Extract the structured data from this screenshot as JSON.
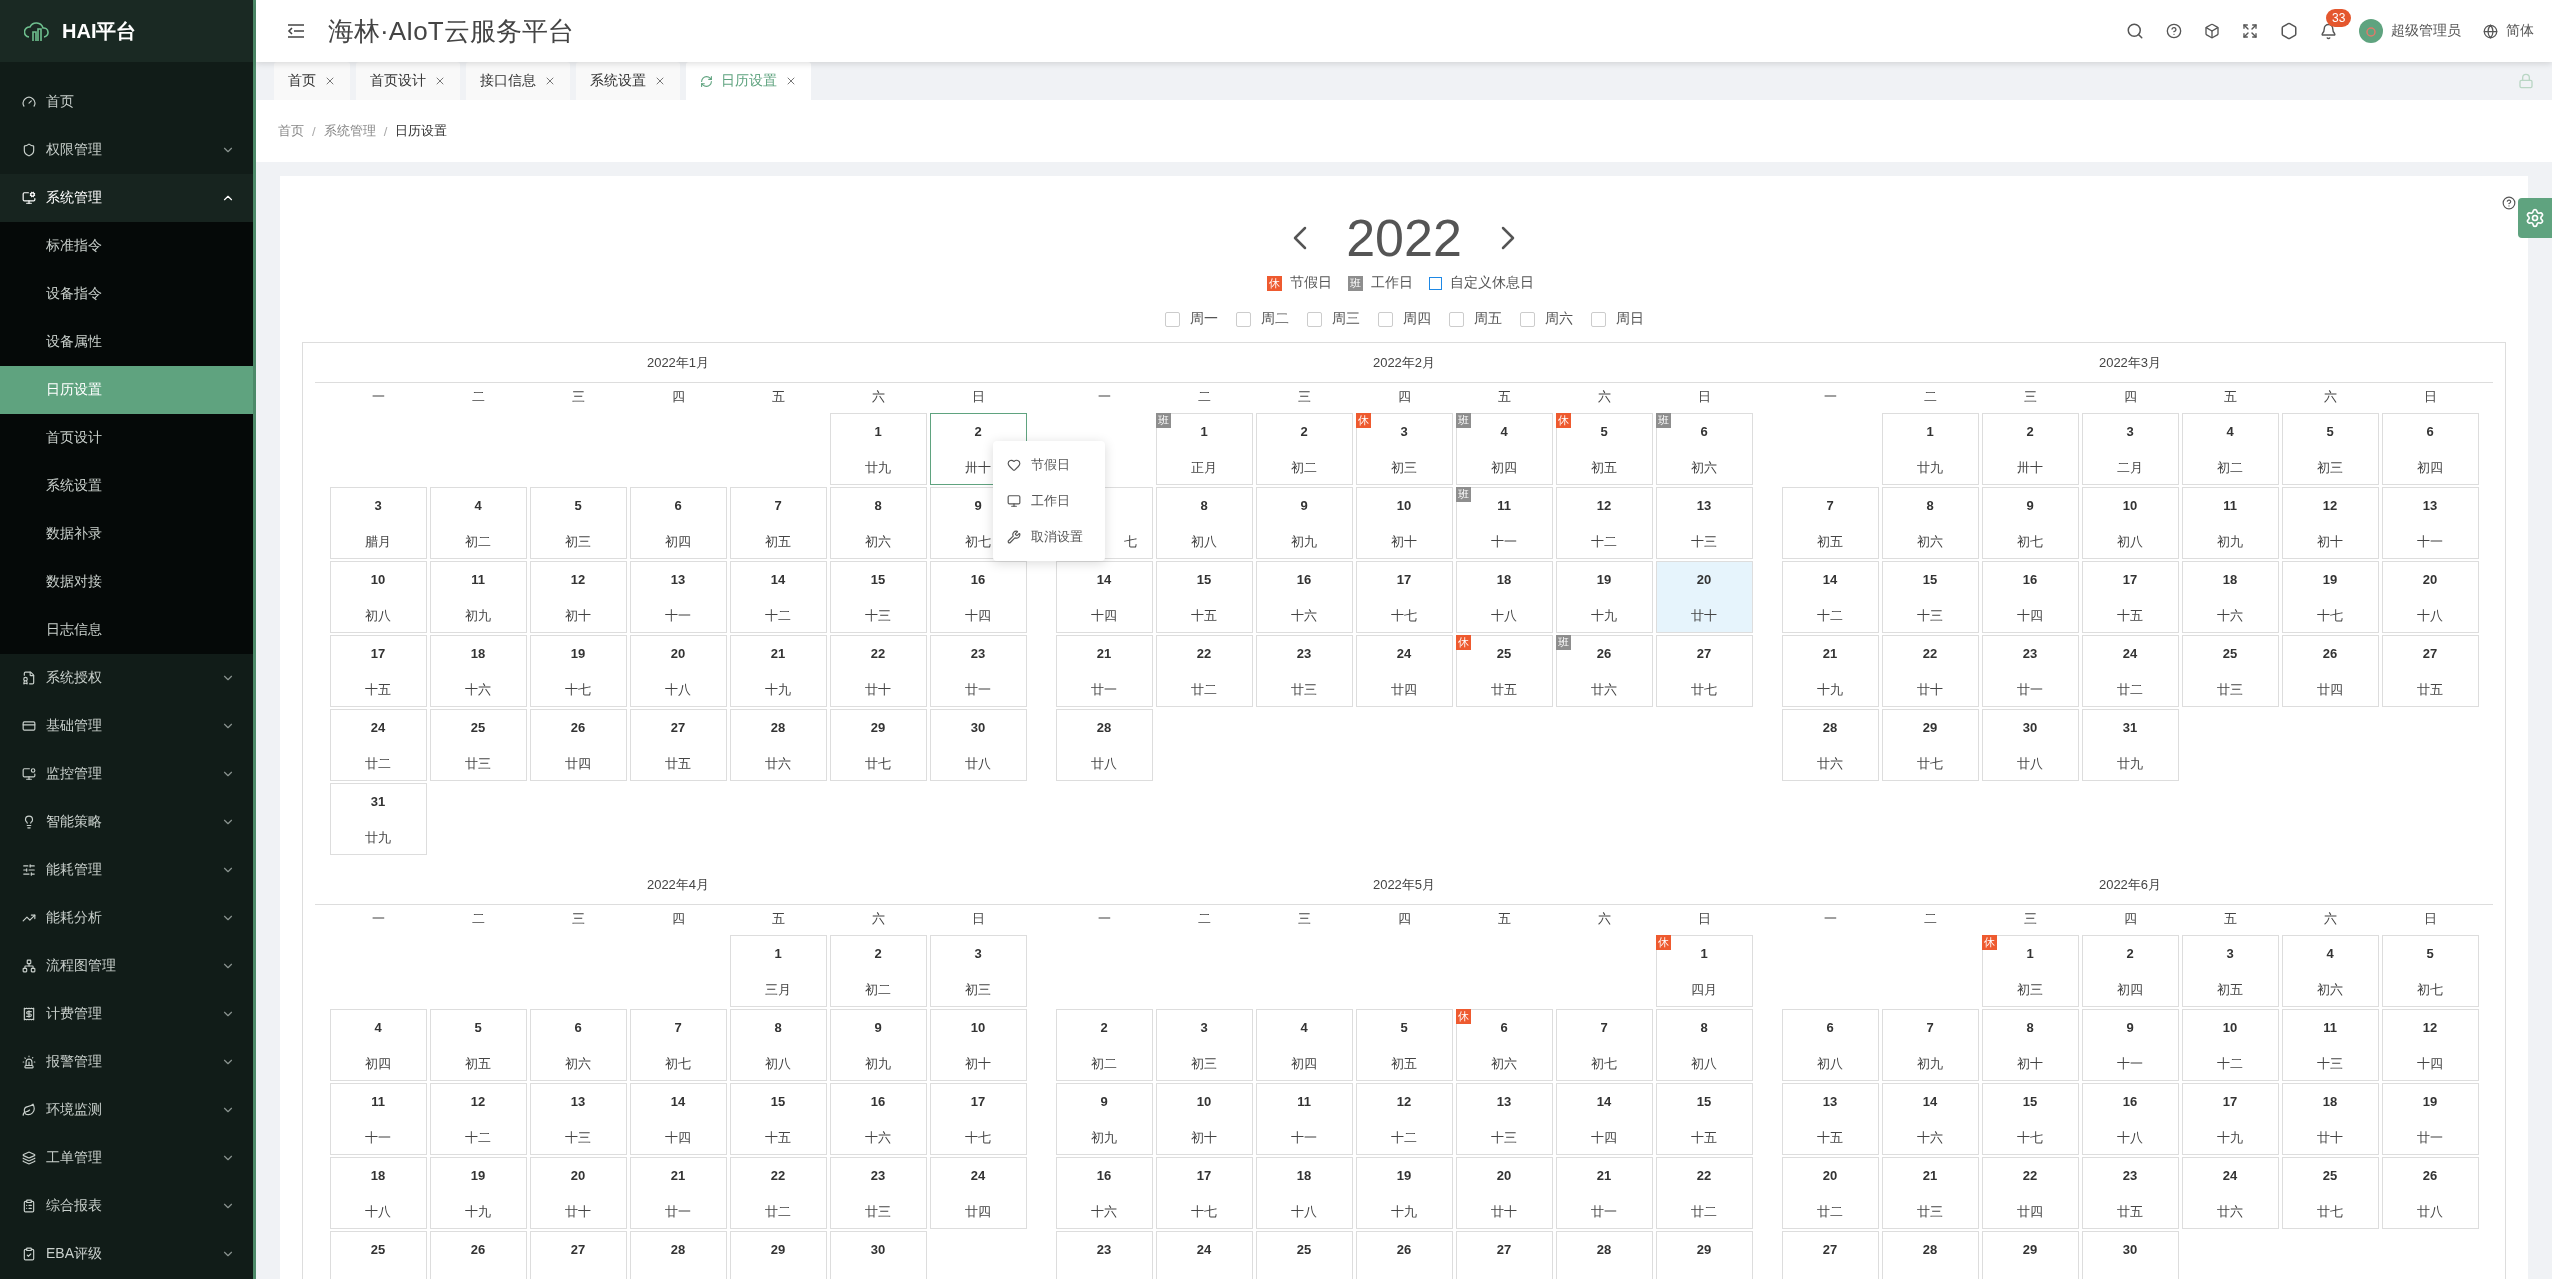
{
  "sidebar": {
    "logo": "HAI平台",
    "items": [
      {
        "kind": "link",
        "label": "首页"
      },
      {
        "kind": "group",
        "label": "权限管理",
        "expanded": false
      },
      {
        "kind": "group",
        "label": "系统管理",
        "expanded": true,
        "children": [
          {
            "label": "标准指令",
            "selected": false
          },
          {
            "label": "设备指令",
            "selected": false
          },
          {
            "label": "设备属性",
            "selected": false
          },
          {
            "label": "日历设置",
            "selected": true
          },
          {
            "label": "首页设计",
            "selected": false
          },
          {
            "label": "系统设置",
            "selected": false
          },
          {
            "label": "数据补录",
            "selected": false
          },
          {
            "label": "数据对接",
            "selected": false
          },
          {
            "label": "日志信息",
            "selected": false
          }
        ]
      },
      {
        "kind": "group",
        "label": "系统授权",
        "expanded": false
      },
      {
        "kind": "group",
        "label": "基础管理",
        "expanded": false
      },
      {
        "kind": "group",
        "label": "监控管理",
        "expanded": false
      },
      {
        "kind": "group",
        "label": "智能策略",
        "expanded": false
      },
      {
        "kind": "group",
        "label": "能耗管理",
        "expanded": false
      },
      {
        "kind": "group",
        "label": "能耗分析",
        "expanded": false
      },
      {
        "kind": "group",
        "label": "流程图管理",
        "expanded": false
      },
      {
        "kind": "group",
        "label": "计费管理",
        "expanded": false
      },
      {
        "kind": "group",
        "label": "报警管理",
        "expanded": false
      },
      {
        "kind": "group",
        "label": "环境监测",
        "expanded": false
      },
      {
        "kind": "group",
        "label": "工单管理",
        "expanded": false
      },
      {
        "kind": "group",
        "label": "综合报表",
        "expanded": false
      },
      {
        "kind": "group",
        "label": "EBA评级",
        "expanded": false
      }
    ]
  },
  "header": {
    "title": "海林·AIoT云服务平台",
    "notifications": "33",
    "user": "超级管理员",
    "language": "简体"
  },
  "tabs": [
    {
      "label": "首页",
      "selected": false
    },
    {
      "label": "首页设计",
      "selected": false
    },
    {
      "label": "接口信息",
      "selected": false
    },
    {
      "label": "系统设置",
      "selected": false
    },
    {
      "label": "日历设置",
      "selected": true
    }
  ],
  "breadcrumb": [
    {
      "label": "首页"
    },
    {
      "separator": "/",
      "label": "系统管理"
    },
    {
      "separator": "/",
      "label": "日历设置"
    }
  ],
  "calendar": {
    "year": "2022",
    "legend": [
      {
        "kind": "holiday",
        "badge": "休",
        "label": "节假日"
      },
      {
        "kind": "workday",
        "badge": "班",
        "label": "工作日"
      },
      {
        "kind": "custom",
        "label": "自定义休息日"
      }
    ],
    "weekday_filters": [
      {
        "label": "周一",
        "checked": false
      },
      {
        "label": "周二",
        "checked": false
      },
      {
        "label": "周三",
        "checked": false
      },
      {
        "label": "周四",
        "checked": false
      },
      {
        "label": "周五",
        "checked": false
      },
      {
        "label": "周六",
        "checked": false
      },
      {
        "label": "周日",
        "checked": false
      }
    ],
    "months": [
      {
        "title": "2022年1月",
        "weekdays": [
          "一",
          "二",
          "三",
          "四",
          "五",
          "六",
          "日"
        ],
        "weeks": [
          [
            {
              "day": "1",
              "lunar": "廿九",
              "selected": false,
              "custom_rest": false
            },
            {
              "day": "2",
              "lunar": "卅十",
              "selected": true,
              "custom_rest": false
            }
          ],
          [
            {
              "day": "3",
              "lunar": "腊月",
              "selected": false,
              "custom_rest": false
            },
            {
              "day": "4",
              "lunar": "初二",
              "selected": false,
              "custom_rest": false
            },
            {
              "day": "5",
              "lunar": "初三",
              "selected": false,
              "custom_rest": false
            },
            {
              "day": "6",
              "lunar": "初四",
              "selected": false,
              "custom_rest": false
            },
            {
              "day": "7",
              "lunar": "初五",
              "selected": false,
              "custom_rest": false
            },
            {
              "day": "8",
              "lunar": "初六",
              "selected": false,
              "custom_rest": false
            },
            {
              "day": "9",
              "lunar": "初七",
              "selected": false,
              "custom_rest": false
            }
          ],
          [
            {
              "day": "10",
              "lunar": "初八",
              "selected": false,
              "custom_rest": false
            },
            {
              "day": "11",
              "lunar": "初九",
              "selected": false,
              "custom_rest": false
            },
            {
              "day": "12",
              "lunar": "初十",
              "selected": false,
              "custom_rest": false
            },
            {
              "day": "13",
              "lunar": "十一",
              "selected": false,
              "custom_rest": false
            },
            {
              "day": "14",
              "lunar": "十二",
              "selected": false,
              "custom_rest": false
            },
            {
              "day": "15",
              "lunar": "十三",
              "selected": false,
              "custom_rest": false
            },
            {
              "day": "16",
              "lunar": "十四",
              "selected": false,
              "custom_rest": false
            }
          ],
          [
            {
              "day": "17",
              "lunar": "十五",
              "selected": false,
              "custom_rest": false
            },
            {
              "day": "18",
              "lunar": "十六",
              "selected": false,
              "custom_rest": false
            },
            {
              "day": "19",
              "lunar": "十七",
              "selected": false,
              "custom_rest": false
            },
            {
              "day": "20",
              "lunar": "十八",
              "selected": false,
              "custom_rest": false
            },
            {
              "day": "21",
              "lunar": "十九",
              "selected": false,
              "custom_rest": false
            },
            {
              "day": "22",
              "lunar": "廿十",
              "selected": false,
              "custom_rest": false
            },
            {
              "day": "23",
              "lunar": "廿一",
              "selected": false,
              "custom_rest": false
            }
          ],
          [
            {
              "day": "24",
              "lunar": "廿二",
              "selected": false,
              "custom_rest": false
            },
            {
              "day": "25",
              "lunar": "廿三",
              "selected": false,
              "custom_rest": false
            },
            {
              "day": "26",
              "lunar": "廿四",
              "selected": false,
              "custom_rest": false
            },
            {
              "day": "27",
              "lunar": "廿五",
              "selected": false,
              "custom_rest": false
            },
            {
              "day": "28",
              "lunar": "廿六",
              "selected": false,
              "custom_rest": false
            },
            {
              "day": "29",
              "lunar": "廿七",
              "selected": false,
              "custom_rest": false
            },
            {
              "day": "30",
              "lunar": "廿八",
              "selected": false,
              "custom_rest": false
            }
          ],
          [
            {
              "day": "31",
              "lunar": "廿九",
              "selected": false,
              "custom_rest": false
            }
          ]
        ]
      },
      {
        "title": "2022年2月",
        "weekdays": [
          "一",
          "二",
          "三",
          "四",
          "五",
          "六",
          "日"
        ],
        "weeks": [
          [
            {
              "day": "1",
              "lunar": "正月",
              "selected": false,
              "custom_rest": false,
              "tag": {
                "kind": "workday",
                "text": "班"
              }
            },
            {
              "day": "2",
              "lunar": "初二",
              "selected": false,
              "custom_rest": false
            },
            {
              "day": "3",
              "lunar": "初三",
              "selected": false,
              "custom_rest": false,
              "tag": {
                "kind": "holiday",
                "text": "休"
              }
            },
            {
              "day": "4",
              "lunar": "初四",
              "selected": false,
              "custom_rest": false,
              "tag": {
                "kind": "workday",
                "text": "班"
              }
            },
            {
              "day": "5",
              "lunar": "初五",
              "selected": false,
              "custom_rest": false,
              "tag": {
                "kind": "holiday",
                "text": "休"
              }
            },
            {
              "day": "6",
              "lunar": "初六",
              "selected": false,
              "custom_rest": false,
              "tag": {
                "kind": "workday",
                "text": "班"
              }
            }
          ],
          [
            {
              "lunar": "七",
              "selected": false,
              "custom_rest": false
            },
            {
              "day": "8",
              "lunar": "初八",
              "selected": false,
              "custom_rest": false
            },
            {
              "day": "9",
              "lunar": "初九",
              "selected": false,
              "custom_rest": false
            },
            {
              "day": "10",
              "lunar": "初十",
              "selected": false,
              "custom_rest": false
            },
            {
              "day": "11",
              "lunar": "十一",
              "selected": false,
              "custom_rest": false,
              "tag": {
                "kind": "workday",
                "text": "班"
              }
            },
            {
              "day": "12",
              "lunar": "十二",
              "selected": false,
              "custom_rest": false
            },
            {
              "day": "13",
              "lunar": "十三",
              "selected": false,
              "custom_rest": false
            }
          ],
          [
            {
              "day": "14",
              "lunar": "十四",
              "selected": false,
              "custom_rest": false
            },
            {
              "day": "15",
              "lunar": "十五",
              "selected": false,
              "custom_rest": false
            },
            {
              "day": "16",
              "lunar": "十六",
              "selected": false,
              "custom_rest": false
            },
            {
              "day": "17",
              "lunar": "十七",
              "selected": false,
              "custom_rest": false
            },
            {
              "day": "18",
              "lunar": "十八",
              "selected": false,
              "custom_rest": false
            },
            {
              "day": "19",
              "lunar": "十九",
              "selected": false,
              "custom_rest": false
            },
            {
              "day": "20",
              "lunar": "廿十",
              "selected": false,
              "custom_rest": true
            }
          ],
          [
            {
              "day": "21",
              "lunar": "廿一",
              "selected": false,
              "custom_rest": false
            },
            {
              "day": "22",
              "lunar": "廿二",
              "selected": false,
              "custom_rest": false
            },
            {
              "day": "23",
              "lunar": "廿三",
              "selected": false,
              "custom_rest": false
            },
            {
              "day": "24",
              "lunar": "廿四",
              "selected": false,
              "custom_rest": false
            },
            {
              "day": "25",
              "lunar": "廿五",
              "selected": false,
              "custom_rest": false,
              "tag": {
                "kind": "holiday",
                "text": "休"
              }
            },
            {
              "day": "26",
              "lunar": "廿六",
              "selected": false,
              "custom_rest": false,
              "tag": {
                "kind": "workday",
                "text": "班"
              }
            },
            {
              "day": "27",
              "lunar": "廿七",
              "selected": false,
              "custom_rest": false
            }
          ],
          [
            {
              "day": "28",
              "lunar": "廿八",
              "selected": false,
              "custom_rest": false
            }
          ]
        ]
      },
      {
        "title": "2022年3月",
        "weekdays": [
          "一",
          "二",
          "三",
          "四",
          "五",
          "六",
          "日"
        ],
        "weeks": [
          [
            {
              "day": "1",
              "lunar": "廿九",
              "selected": false,
              "custom_rest": false
            },
            {
              "day": "2",
              "lunar": "卅十",
              "selected": false,
              "custom_rest": false
            },
            {
              "day": "3",
              "lunar": "二月",
              "selected": false,
              "custom_rest": false
            },
            {
              "day": "4",
              "lunar": "初二",
              "selected": false,
              "custom_rest": false
            },
            {
              "day": "5",
              "lunar": "初三",
              "selected": false,
              "custom_rest": false
            },
            {
              "day": "6",
              "lunar": "初四",
              "selected": false,
              "custom_rest": false
            }
          ],
          [
            {
              "day": "7",
              "lunar": "初五",
              "selected": false,
              "custom_rest": false
            },
            {
              "day": "8",
              "lunar": "初六",
              "selected": false,
              "custom_rest": false
            },
            {
              "day": "9",
              "lunar": "初七",
              "selected": false,
              "custom_rest": false
            },
            {
              "day": "10",
              "lunar": "初八",
              "selected": false,
              "custom_rest": false
            },
            {
              "day": "11",
              "lunar": "初九",
              "selected": false,
              "custom_rest": false
            },
            {
              "day": "12",
              "lunar": "初十",
              "selected": false,
              "custom_rest": false
            },
            {
              "day": "13",
              "lunar": "十一",
              "selected": false,
              "custom_rest": false
            }
          ],
          [
            {
              "day": "14",
              "lunar": "十二",
              "selected": false,
              "custom_rest": false
            },
            {
              "day": "15",
              "lunar": "十三",
              "selected": false,
              "custom_rest": false
            },
            {
              "day": "16",
              "lunar": "十四",
              "selected": false,
              "custom_rest": false
            },
            {
              "day": "17",
              "lunar": "十五",
              "selected": false,
              "custom_rest": false
            },
            {
              "day": "18",
              "lunar": "十六",
              "selected": false,
              "custom_rest": false
            },
            {
              "day": "19",
              "lunar": "十七",
              "selected": false,
              "custom_rest": false
            },
            {
              "day": "20",
              "lunar": "十八",
              "selected": false,
              "custom_rest": false
            }
          ],
          [
            {
              "day": "21",
              "lunar": "十九",
              "selected": false,
              "custom_rest": false
            },
            {
              "day": "22",
              "lunar": "廿十",
              "selected": false,
              "custom_rest": false
            },
            {
              "day": "23",
              "lunar": "廿一",
              "selected": false,
              "custom_rest": false
            },
            {
              "day": "24",
              "lunar": "廿二",
              "selected": false,
              "custom_rest": false
            },
            {
              "day": "25",
              "lunar": "廿三",
              "selected": false,
              "custom_rest": false
            },
            {
              "day": "26",
              "lunar": "廿四",
              "selected": false,
              "custom_rest": false
            },
            {
              "day": "27",
              "lunar": "廿五",
              "selected": false,
              "custom_rest": false
            }
          ],
          [
            {
              "day": "28",
              "lunar": "廿六",
              "selected": false,
              "custom_rest": false
            },
            {
              "day": "29",
              "lunar": "廿七",
              "selected": false,
              "custom_rest": false
            },
            {
              "day": "30",
              "lunar": "廿八",
              "selected": false,
              "custom_rest": false
            },
            {
              "day": "31",
              "lunar": "廿九",
              "selected": false,
              "custom_rest": false
            }
          ]
        ]
      },
      {
        "title": "2022年4月",
        "weekdays": [
          "一",
          "二",
          "三",
          "四",
          "五",
          "六",
          "日"
        ],
        "weeks": [
          [
            {
              "day": "1",
              "lunar": "三月",
              "selected": false,
              "custom_rest": false
            },
            {
              "day": "2",
              "lunar": "初二",
              "selected": false,
              "custom_rest": false
            },
            {
              "day": "3",
              "lunar": "初三",
              "selected": false,
              "custom_rest": false
            }
          ],
          [
            {
              "day": "4",
              "lunar": "初四",
              "selected": false,
              "custom_rest": false
            },
            {
              "day": "5",
              "lunar": "初五",
              "selected": false,
              "custom_rest": false
            },
            {
              "day": "6",
              "lunar": "初六",
              "selected": false,
              "custom_rest": false
            },
            {
              "day": "7",
              "lunar": "初七",
              "selected": false,
              "custom_rest": false
            },
            {
              "day": "8",
              "lunar": "初八",
              "selected": false,
              "custom_rest": false
            },
            {
              "day": "9",
              "lunar": "初九",
              "selected": false,
              "custom_rest": false
            },
            {
              "day": "10",
              "lunar": "初十",
              "selected": false,
              "custom_rest": false
            }
          ],
          [
            {
              "day": "11",
              "lunar": "十一",
              "selected": false,
              "custom_rest": false
            },
            {
              "day": "12",
              "lunar": "十二",
              "selected": false,
              "custom_rest": false
            },
            {
              "day": "13",
              "lunar": "十三",
              "selected": false,
              "custom_rest": false
            },
            {
              "day": "14",
              "lunar": "十四",
              "selected": false,
              "custom_rest": false
            },
            {
              "day": "15",
              "lunar": "十五",
              "selected": false,
              "custom_rest": false
            },
            {
              "day": "16",
              "lunar": "十六",
              "selected": false,
              "custom_rest": false
            },
            {
              "day": "17",
              "lunar": "十七",
              "selected": false,
              "custom_rest": false
            }
          ],
          [
            {
              "day": "18",
              "lunar": "十八",
              "selected": false,
              "custom_rest": false
            },
            {
              "day": "19",
              "lunar": "十九",
              "selected": false,
              "custom_rest": false
            },
            {
              "day": "20",
              "lunar": "廿十",
              "selected": false,
              "custom_rest": false
            },
            {
              "day": "21",
              "lunar": "廿一",
              "selected": false,
              "custom_rest": false
            },
            {
              "day": "22",
              "lunar": "廿二",
              "selected": false,
              "custom_rest": false
            },
            {
              "day": "23",
              "lunar": "廿三",
              "selected": false,
              "custom_rest": false
            },
            {
              "day": "24",
              "lunar": "廿四",
              "selected": false,
              "custom_rest": false
            }
          ],
          [
            {
              "day": "25",
              "selected": false,
              "custom_rest": false
            },
            {
              "day": "26",
              "selected": false,
              "custom_rest": false
            },
            {
              "day": "27",
              "selected": false,
              "custom_rest": false
            },
            {
              "day": "28",
              "selected": false,
              "custom_rest": false
            },
            {
              "day": "29",
              "selected": false,
              "custom_rest": false
            },
            {
              "day": "30",
              "selected": false,
              "custom_rest": false
            }
          ]
        ]
      },
      {
        "title": "2022年5月",
        "weekdays": [
          "一",
          "二",
          "三",
          "四",
          "五",
          "六",
          "日"
        ],
        "weeks": [
          [
            {
              "day": "1",
              "lunar": "四月",
              "selected": false,
              "custom_rest": false,
              "tag": {
                "kind": "holiday",
                "text": "休"
              }
            }
          ],
          [
            {
              "day": "2",
              "lunar": "初二",
              "selected": false,
              "custom_rest": false
            },
            {
              "day": "3",
              "lunar": "初三",
              "selected": false,
              "custom_rest": false
            },
            {
              "day": "4",
              "lunar": "初四",
              "selected": false,
              "custom_rest": false
            },
            {
              "day": "5",
              "lunar": "初五",
              "selected": false,
              "custom_rest": false
            },
            {
              "day": "6",
              "lunar": "初六",
              "selected": false,
              "custom_rest": false,
              "tag": {
                "kind": "holiday",
                "text": "休"
              }
            },
            {
              "day": "7",
              "lunar": "初七",
              "selected": false,
              "custom_rest": false
            },
            {
              "day": "8",
              "lunar": "初八",
              "selected": false,
              "custom_rest": false
            }
          ],
          [
            {
              "day": "9",
              "lunar": "初九",
              "selected": false,
              "custom_rest": false
            },
            {
              "day": "10",
              "lunar": "初十",
              "selected": false,
              "custom_rest": false
            },
            {
              "day": "11",
              "lunar": "十一",
              "selected": false,
              "custom_rest": false
            },
            {
              "day": "12",
              "lunar": "十二",
              "selected": false,
              "custom_rest": false
            },
            {
              "day": "13",
              "lunar": "十三",
              "selected": false,
              "custom_rest": false
            },
            {
              "day": "14",
              "lunar": "十四",
              "selected": false,
              "custom_rest": false
            },
            {
              "day": "15",
              "lunar": "十五",
              "selected": false,
              "custom_rest": false
            }
          ],
          [
            {
              "day": "16",
              "lunar": "十六",
              "selected": false,
              "custom_rest": false
            },
            {
              "day": "17",
              "lunar": "十七",
              "selected": false,
              "custom_rest": false
            },
            {
              "day": "18",
              "lunar": "十八",
              "selected": false,
              "custom_rest": false
            },
            {
              "day": "19",
              "lunar": "十九",
              "selected": false,
              "custom_rest": false
            },
            {
              "day": "20",
              "lunar": "廿十",
              "selected": false,
              "custom_rest": false
            },
            {
              "day": "21",
              "lunar": "廿一",
              "selected": false,
              "custom_rest": false
            },
            {
              "day": "22",
              "lunar": "廿二",
              "selected": false,
              "custom_rest": false
            }
          ],
          [
            {
              "day": "23",
              "selected": false,
              "custom_rest": false
            },
            {
              "day": "24",
              "selected": false,
              "custom_rest": false
            },
            {
              "day": "25",
              "selected": false,
              "custom_rest": false
            },
            {
              "day": "26",
              "selected": false,
              "custom_rest": false
            },
            {
              "day": "27",
              "selected": false,
              "custom_rest": false
            },
            {
              "day": "28",
              "selected": false,
              "custom_rest": false
            },
            {
              "day": "29",
              "selected": false,
              "custom_rest": false
            }
          ]
        ]
      },
      {
        "title": "2022年6月",
        "weekdays": [
          "一",
          "二",
          "三",
          "四",
          "五",
          "六",
          "日"
        ],
        "weeks": [
          [
            {
              "day": "1",
              "lunar": "初三",
              "selected": false,
              "custom_rest": false,
              "tag": {
                "kind": "holiday",
                "text": "休"
              }
            },
            {
              "day": "2",
              "lunar": "初四",
              "selected": false,
              "custom_rest": false
            },
            {
              "day": "3",
              "lunar": "初五",
              "selected": false,
              "custom_rest": false
            },
            {
              "day": "4",
              "lunar": "初六",
              "selected": false,
              "custom_rest": false
            },
            {
              "day": "5",
              "lunar": "初七",
              "selected": false,
              "custom_rest": false
            }
          ],
          [
            {
              "day": "6",
              "lunar": "初八",
              "selected": false,
              "custom_rest": false
            },
            {
              "day": "7",
              "lunar": "初九",
              "selected": false,
              "custom_rest": false
            },
            {
              "day": "8",
              "lunar": "初十",
              "selected": false,
              "custom_rest": false
            },
            {
              "day": "9",
              "lunar": "十一",
              "selected": false,
              "custom_rest": false
            },
            {
              "day": "10",
              "lunar": "十二",
              "selected": false,
              "custom_rest": false
            },
            {
              "day": "11",
              "lunar": "十三",
              "selected": false,
              "custom_rest": false
            },
            {
              "day": "12",
              "lunar": "十四",
              "selected": false,
              "custom_rest": false
            }
          ],
          [
            {
              "day": "13",
              "lunar": "十五",
              "selected": false,
              "custom_rest": false
            },
            {
              "day": "14",
              "lunar": "十六",
              "selected": false,
              "custom_rest": false
            },
            {
              "day": "15",
              "lunar": "十七",
              "selected": false,
              "custom_rest": false
            },
            {
              "day": "16",
              "lunar": "十八",
              "selected": false,
              "custom_rest": false
            },
            {
              "day": "17",
              "lunar": "十九",
              "selected": false,
              "custom_rest": false
            },
            {
              "day": "18",
              "lunar": "廿十",
              "selected": false,
              "custom_rest": false
            },
            {
              "day": "19",
              "lunar": "廿一",
              "selected": false,
              "custom_rest": false
            }
          ],
          [
            {
              "day": "20",
              "lunar": "廿二",
              "selected": false,
              "custom_rest": false
            },
            {
              "day": "21",
              "lunar": "廿三",
              "selected": false,
              "custom_rest": false
            },
            {
              "day": "22",
              "lunar": "廿四",
              "selected": false,
              "custom_rest": false
            },
            {
              "day": "23",
              "lunar": "廿五",
              "selected": false,
              "custom_rest": false
            },
            {
              "day": "24",
              "lunar": "廿六",
              "selected": false,
              "custom_rest": false
            },
            {
              "day": "25",
              "lunar": "廿七",
              "selected": false,
              "custom_rest": false
            },
            {
              "day": "26",
              "lunar": "廿八",
              "selected": false,
              "custom_rest": false
            }
          ],
          [
            {
              "day": "27",
              "selected": false,
              "custom_rest": false
            },
            {
              "day": "28",
              "selected": false,
              "custom_rest": false
            },
            {
              "day": "29",
              "selected": false,
              "custom_rest": false
            },
            {
              "day": "30",
              "selected": false,
              "custom_rest": false
            }
          ]
        ]
      }
    ],
    "context_menu": {
      "items": [
        {
          "kind": "holiday",
          "label": "节假日"
        },
        {
          "kind": "workday",
          "label": "工作日"
        },
        {
          "kind": "clear",
          "label": "取消设置"
        }
      ]
    }
  }
}
